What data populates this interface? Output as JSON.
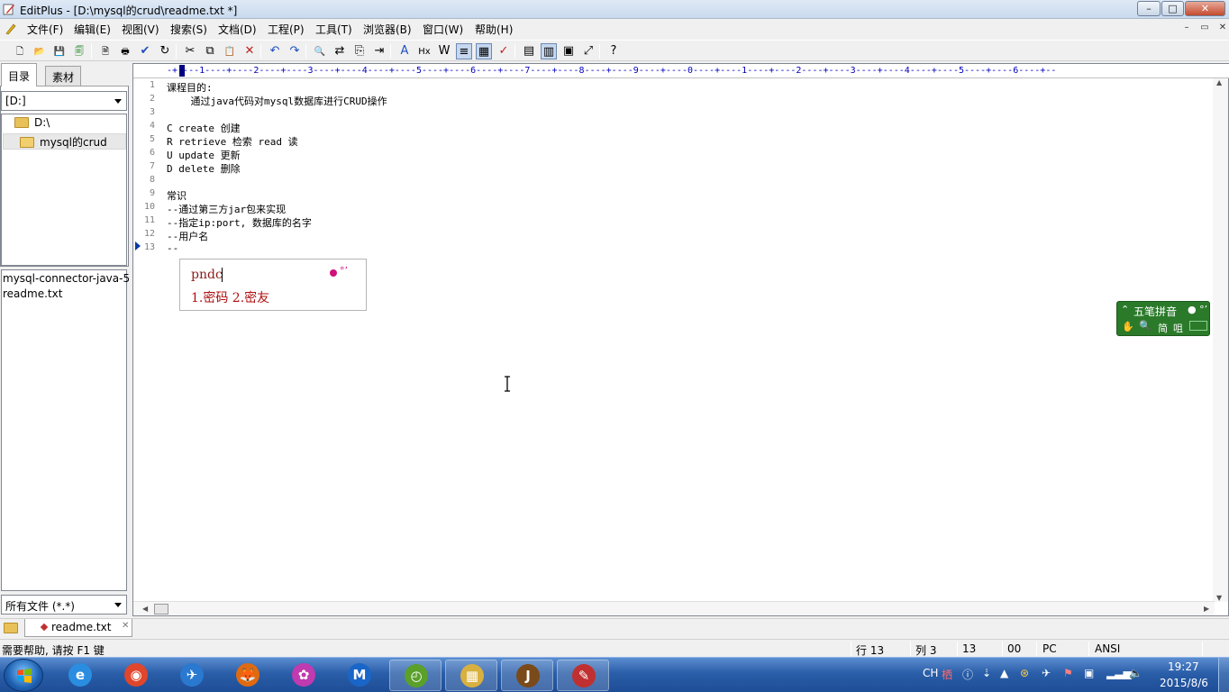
{
  "window": {
    "title": "EditPlus - [D:\\mysql的crud\\readme.txt *]",
    "controls": {
      "minimize": "–",
      "maximize": "□",
      "close": "✕"
    }
  },
  "menu": {
    "items": [
      "文件(F)",
      "编辑(E)",
      "视图(V)",
      "搜索(S)",
      "文档(D)",
      "工程(P)",
      "工具(T)",
      "浏览器(B)",
      "窗口(W)",
      "帮助(H)"
    ],
    "mdi_controls": [
      "–",
      "▭",
      "✕"
    ]
  },
  "toolbar": {
    "buttons": [
      {
        "icon": "new-file-icon",
        "glyph": "🗋"
      },
      {
        "icon": "open-folder-icon",
        "glyph": "📂"
      },
      {
        "icon": "save-icon",
        "glyph": "💾"
      },
      {
        "icon": "save-all-icon",
        "glyph": "🗐"
      },
      {
        "icon": "print-preview-icon",
        "glyph": "🗎"
      },
      {
        "icon": "print-icon",
        "glyph": "🖶"
      },
      {
        "icon": "spell-check-icon",
        "glyph": "✔"
      },
      {
        "icon": "refresh-icon",
        "glyph": "↻"
      },
      {
        "icon": "cut-icon",
        "glyph": "✂"
      },
      {
        "icon": "copy-icon",
        "glyph": "⧉"
      },
      {
        "icon": "paste-icon",
        "glyph": "📋"
      },
      {
        "icon": "delete-icon",
        "glyph": "✕"
      },
      {
        "icon": "undo-icon",
        "glyph": "↶"
      },
      {
        "icon": "redo-icon",
        "glyph": "↷"
      },
      {
        "icon": "find-icon",
        "glyph": "🔍"
      },
      {
        "icon": "replace-icon",
        "glyph": "⇄"
      },
      {
        "icon": "find-in-files-icon",
        "glyph": "⎘"
      },
      {
        "icon": "goto-line-icon",
        "glyph": "⇥"
      },
      {
        "icon": "font-icon",
        "glyph": "A"
      },
      {
        "icon": "html-heading-icon",
        "glyph": "Hx"
      },
      {
        "icon": "word-wrap-icon",
        "glyph": "W"
      },
      {
        "icon": "line-numbers-icon",
        "glyph": "≡"
      },
      {
        "icon": "ruler-icon",
        "glyph": "▦"
      },
      {
        "icon": "check-icon",
        "glyph": "✓"
      },
      {
        "icon": "cliptext-icon",
        "glyph": "▤"
      },
      {
        "icon": "directory-icon",
        "glyph": "▥"
      },
      {
        "icon": "output-window-icon",
        "glyph": "▣"
      },
      {
        "icon": "fullscreen-icon",
        "glyph": "⤢"
      },
      {
        "icon": "help-context-icon",
        "glyph": "?"
      }
    ],
    "colors": {
      "red": "#c02020",
      "blue": "#1f4fbf",
      "green": "#2a8a2a"
    }
  },
  "sidebar": {
    "tabs": [
      "目录",
      "素材"
    ],
    "drive": "[D:]",
    "tree": [
      {
        "label": "D:\\"
      },
      {
        "label": "mysql的crud"
      }
    ],
    "files": [
      "mysql-connector-java-5",
      "readme.txt"
    ],
    "filter": "所有文件 (*.*)"
  },
  "editor": {
    "ruler": "-+----1----+----2----+----3----+----4----+----5----+----6----+----7----+----8----+----9----+----0----+----1----+----2----+----3----+----4----+----5----+----6----+--",
    "lines": [
      {
        "no": "1",
        "text": "课程目的:"
      },
      {
        "no": "2",
        "text": "    通过java代码对mysql数据库进行CRUD操作"
      },
      {
        "no": "3",
        "text": ""
      },
      {
        "no": "4",
        "text": "C create 创建"
      },
      {
        "no": "5",
        "text": "R retrieve 检索 read 读"
      },
      {
        "no": "6",
        "text": "U update 更新"
      },
      {
        "no": "7",
        "text": "D delete 删除"
      },
      {
        "no": "8",
        "text": ""
      },
      {
        "no": "9",
        "text": "常识"
      },
      {
        "no": "10",
        "text": "--通过第三方jar包来实现"
      },
      {
        "no": "11",
        "text": "--指定ip:port, 数据库的名字"
      },
      {
        "no": "12",
        "text": "--用户名"
      },
      {
        "no": "13",
        "text": "--"
      }
    ]
  },
  "ime_popup": {
    "input": "pndc",
    "candidates": "1.密码 2.密友",
    "moon": "°’",
    "accent": "#d0107a"
  },
  "ime_bar": {
    "name": "五笔拼音",
    "simplified": "简",
    "fullwidth": "咀",
    "bg": "#2a7a2a"
  },
  "file_tabs": [
    {
      "label": "readme.txt"
    }
  ],
  "status": {
    "help": "需要帮助, 请按 F1 键",
    "line": "行 13",
    "col": "列 3",
    "count": "13",
    "code": "00",
    "mode": "PC",
    "encoding": "ANSI"
  },
  "taskbar": {
    "apps": [
      {
        "name": "ie-icon",
        "glyph": "e",
        "color": "#2a8de0"
      },
      {
        "name": "chrome-icon",
        "glyph": "◉",
        "color": "#e0462c"
      },
      {
        "name": "feiq-icon",
        "glyph": "✈",
        "color": "#2a79d0"
      },
      {
        "name": "firefox-icon",
        "glyph": "🦊",
        "color": "#e06a10"
      },
      {
        "name": "picasa-icon",
        "glyph": "✿",
        "color": "#c03ab0"
      },
      {
        "name": "maxthon-icon",
        "glyph": "M",
        "color": "#1a66c8"
      },
      {
        "name": "alarm-app-icon",
        "glyph": "◴",
        "color": "#5aa02a"
      },
      {
        "name": "explorer-icon",
        "glyph": "▦",
        "color": "#d8b040"
      },
      {
        "name": "javaee-ide-icon",
        "glyph": "J",
        "color": "#7a4a1a"
      },
      {
        "name": "editplus-icon",
        "glyph": "✎",
        "color": "#c03030"
      }
    ],
    "tray": {
      "lang": "CH",
      "time": "19:27",
      "date": "2015/8/6"
    }
  }
}
